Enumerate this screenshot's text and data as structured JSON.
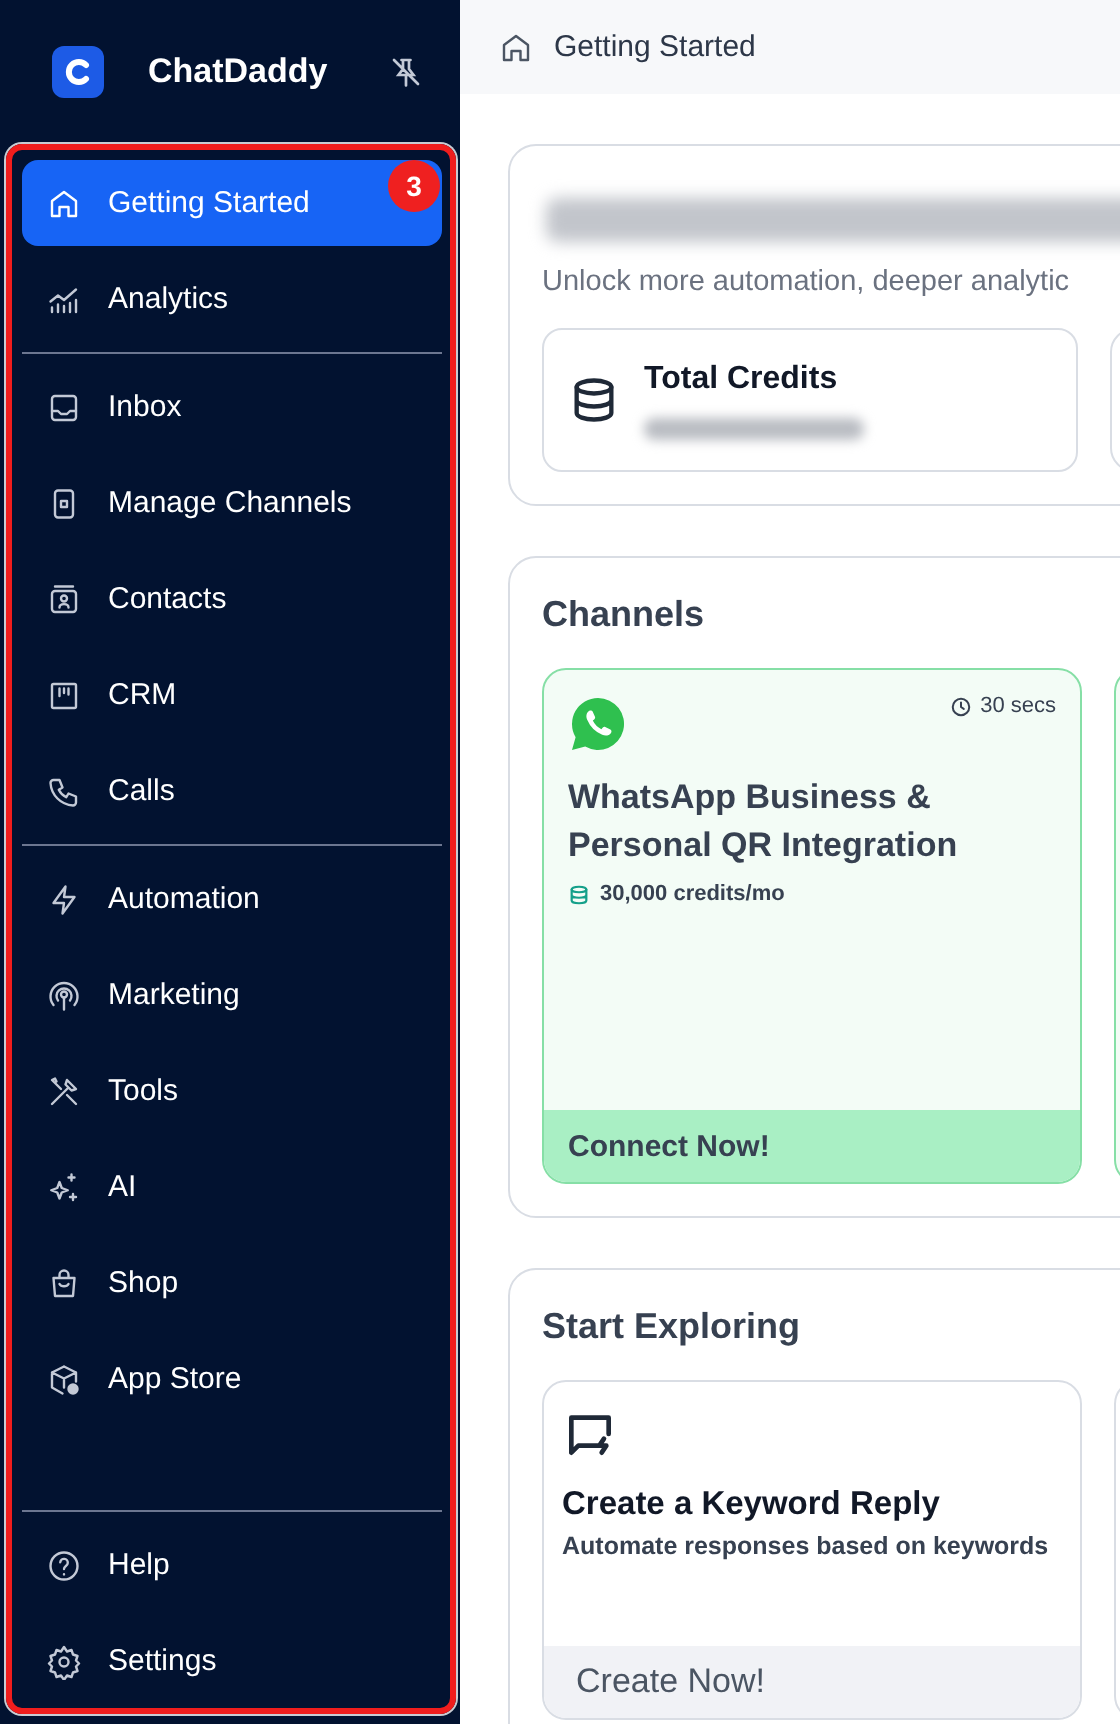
{
  "sidebar": {
    "brand": "ChatDaddy",
    "highlight": {
      "badge": "3"
    },
    "sections": [
      [
        {
          "label": "Getting Started",
          "selected": true
        },
        {
          "label": "Analytics",
          "selected": false
        }
      ],
      [
        {
          "label": "Inbox",
          "selected": false
        },
        {
          "label": "Manage Channels",
          "selected": false
        },
        {
          "label": "Contacts",
          "selected": false
        },
        {
          "label": "CRM",
          "selected": false
        },
        {
          "label": "Calls",
          "selected": false
        }
      ],
      [
        {
          "label": "Automation",
          "selected": false
        },
        {
          "label": "Marketing",
          "selected": false
        },
        {
          "label": "Tools",
          "selected": false
        },
        {
          "label": "AI",
          "selected": false
        },
        {
          "label": "Shop",
          "selected": false
        },
        {
          "label": "App Store",
          "selected": false
        }
      ]
    ],
    "footer": [
      {
        "label": "Help",
        "selected": false
      },
      {
        "label": "Settings",
        "selected": false
      }
    ]
  },
  "breadcrumb": "Getting Started",
  "welcome": {
    "subtitle": "Unlock more automation, deeper analytic",
    "stats": [
      {
        "label": "Total Credits"
      }
    ]
  },
  "channels": {
    "title": "Channels",
    "cards": [
      {
        "duration": "30 secs",
        "title": "WhatsApp Business & Personal QR Integration",
        "credits": "30,000 credits/mo",
        "action": "Connect Now!"
      }
    ]
  },
  "explore": {
    "title": "Start Exploring",
    "cards": [
      {
        "title": "Create a Keyword Reply",
        "description": "Automate responses based on keywords",
        "action": "Create Now!"
      }
    ]
  }
}
